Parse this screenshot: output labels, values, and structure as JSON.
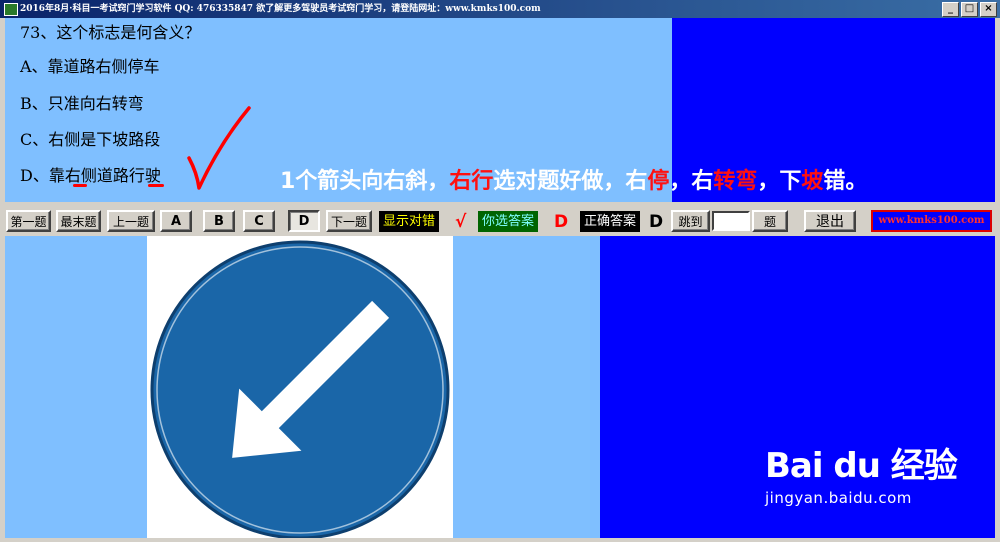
{
  "window": {
    "title": "2016年8月·科目一考试窍门学习软件  QQ: 476335847 欲了解更多驾驶员考试窍门学习，请登陆网址：www.kmks100.com",
    "min_label": "_",
    "max_label": "□",
    "close_label": "×"
  },
  "question": {
    "text": "73、这个标志是何含义？",
    "options": [
      "A、靠道路右侧停车",
      "B、只准向右转弯",
      "C、右侧是下坡路段",
      "D、靠右侧道路行驶"
    ]
  },
  "hint": {
    "parts": [
      "1个箭头向右斜，",
      "右行",
      "选对题好做，右",
      "停",
      "，右",
      "转弯",
      "，下",
      "坡",
      "错。"
    ]
  },
  "toolbar": {
    "first": "第一题",
    "last": "最末题",
    "prev": "上一题",
    "a": "A",
    "b": "B",
    "c": "C",
    "d": "D",
    "next": "下一题",
    "show_correct": "显示对错",
    "check_mark": "√",
    "your_answer_label": "你选答案",
    "your_answer": "D",
    "correct_answer_label": "正确答案",
    "correct_answer": "D",
    "jump": "跳到",
    "jump_suffix": "题",
    "exit": "退出",
    "site": "www.kmks100.com"
  },
  "watermark": {
    "logo": "Bai du 经验",
    "url": "jingyan.baidu.com"
  },
  "colors": {
    "panel_light_blue": "#7fbfff",
    "panel_blue": "#0000ff",
    "sign_blue": "#1a66a8",
    "accent_red": "#ff0000"
  }
}
